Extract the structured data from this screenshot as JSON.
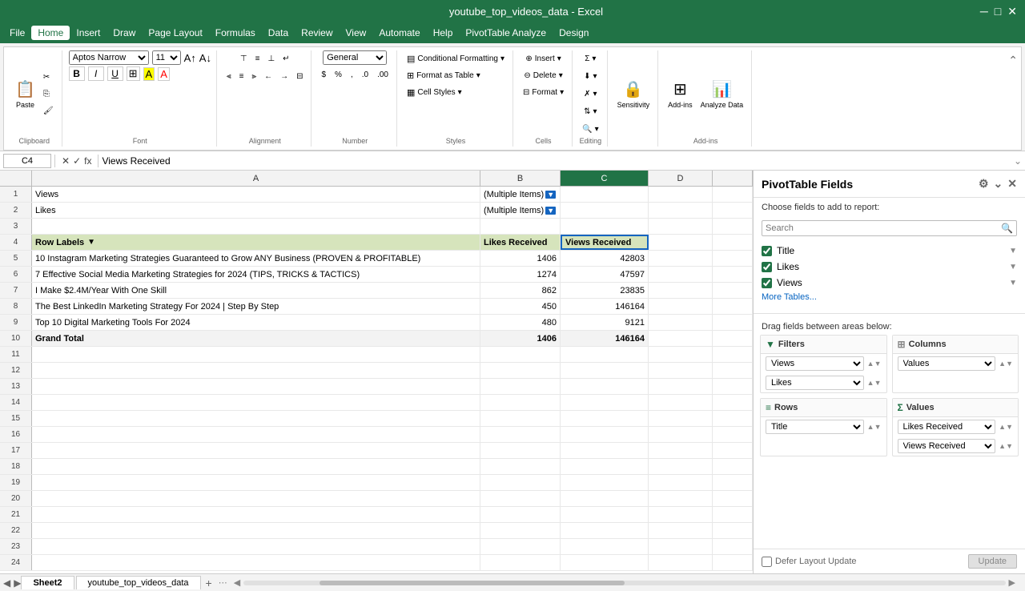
{
  "titleBar": {
    "title": "youtube_top_videos_data - Excel"
  },
  "menuBar": {
    "items": [
      "File",
      "Home",
      "Insert",
      "Draw",
      "Page Layout",
      "Formulas",
      "Data",
      "Review",
      "View",
      "Automate",
      "Help",
      "PivotTable Analyze",
      "Design"
    ]
  },
  "ribbon": {
    "groups": {
      "clipboard": {
        "label": "Clipboard",
        "paste": "Paste"
      },
      "font": {
        "label": "Font",
        "fontName": "Aptos Narrow",
        "fontSize": "11",
        "bold": "B",
        "italic": "I",
        "underline": "U"
      },
      "alignment": {
        "label": "Alignment"
      },
      "number": {
        "label": "Number",
        "format": "General"
      },
      "styles": {
        "label": "Styles",
        "conditionalFormatting": "Conditional Formatting",
        "formatAsTable": "Format as Table",
        "cellStyles": "Cell Styles"
      },
      "cells": {
        "label": "Cells",
        "insert": "Insert",
        "delete": "Delete",
        "format": "Format"
      },
      "editing": {
        "label": "Editing"
      },
      "sensitivity": {
        "label": "Sensitivity"
      },
      "addins": {
        "label": "Add-ins",
        "addins": "Add-ins",
        "analyzeData": "Analyze Data"
      }
    }
  },
  "formulaBar": {
    "cellRef": "C4",
    "formula": "Views Received"
  },
  "spreadsheet": {
    "columns": [
      "A",
      "B",
      "C",
      "D"
    ],
    "rows": [
      {
        "num": "1",
        "cells": [
          {
            "col": "A",
            "value": "Views",
            "type": "text"
          },
          {
            "col": "B",
            "value": "(Multiple Items)",
            "type": "text",
            "hasFilter": true
          },
          {
            "col": "C",
            "value": "",
            "type": "text"
          },
          {
            "col": "D",
            "value": "",
            "type": "text"
          }
        ]
      },
      {
        "num": "2",
        "cells": [
          {
            "col": "A",
            "value": "Likes",
            "type": "text"
          },
          {
            "col": "B",
            "value": "(Multiple Items)",
            "type": "text",
            "hasFilter": true
          },
          {
            "col": "C",
            "value": "",
            "type": "text"
          },
          {
            "col": "D",
            "value": "",
            "type": "text"
          }
        ]
      },
      {
        "num": "3",
        "cells": [
          {
            "col": "A",
            "value": "",
            "type": "text"
          },
          {
            "col": "B",
            "value": "",
            "type": "text"
          },
          {
            "col": "C",
            "value": "",
            "type": "text"
          },
          {
            "col": "D",
            "value": "",
            "type": "text"
          }
        ]
      },
      {
        "num": "4",
        "cells": [
          {
            "col": "A",
            "value": "Row Labels",
            "type": "header",
            "hasDropdown": true
          },
          {
            "col": "B",
            "value": "Likes Received",
            "type": "header"
          },
          {
            "col": "C",
            "value": "Views Received",
            "type": "header",
            "selected": true
          },
          {
            "col": "D",
            "value": "",
            "type": "text"
          }
        ]
      },
      {
        "num": "5",
        "cells": [
          {
            "col": "A",
            "value": "10 Instagram Marketing Strategies Guaranteed to Grow ANY Business (PROVEN & PROFITABLE)",
            "type": "text"
          },
          {
            "col": "B",
            "value": "1406",
            "type": "num"
          },
          {
            "col": "C",
            "value": "42803",
            "type": "num"
          },
          {
            "col": "D",
            "value": "",
            "type": "text"
          }
        ]
      },
      {
        "num": "6",
        "cells": [
          {
            "col": "A",
            "value": "7 Effective Social Media Marketing Strategies for 2024 (TIPS, TRICKS & TACTICS)",
            "type": "text"
          },
          {
            "col": "B",
            "value": "1274",
            "type": "num"
          },
          {
            "col": "C",
            "value": "47597",
            "type": "num"
          },
          {
            "col": "D",
            "value": "",
            "type": "text"
          }
        ]
      },
      {
        "num": "7",
        "cells": [
          {
            "col": "A",
            "value": "I Make $2.4M/Year With One Skill",
            "type": "text"
          },
          {
            "col": "B",
            "value": "862",
            "type": "num"
          },
          {
            "col": "C",
            "value": "23835",
            "type": "num"
          },
          {
            "col": "D",
            "value": "",
            "type": "text"
          }
        ]
      },
      {
        "num": "8",
        "cells": [
          {
            "col": "A",
            "value": "The Best LinkedIn Marketing Strategy For 2024 | Step By Step",
            "type": "text"
          },
          {
            "col": "B",
            "value": "450",
            "type": "num"
          },
          {
            "col": "C",
            "value": "146164",
            "type": "num"
          },
          {
            "col": "D",
            "value": "",
            "type": "text"
          }
        ]
      },
      {
        "num": "9",
        "cells": [
          {
            "col": "A",
            "value": "Top 10 Digital Marketing Tools For 2024",
            "type": "text"
          },
          {
            "col": "B",
            "value": "480",
            "type": "num"
          },
          {
            "col": "C",
            "value": "9121",
            "type": "num"
          },
          {
            "col": "D",
            "value": "",
            "type": "text"
          }
        ]
      },
      {
        "num": "10",
        "cells": [
          {
            "col": "A",
            "value": "Grand Total",
            "type": "total"
          },
          {
            "col": "B",
            "value": "1406",
            "type": "total-num"
          },
          {
            "col": "C",
            "value": "146164",
            "type": "total-num"
          },
          {
            "col": "D",
            "value": "",
            "type": "text"
          }
        ]
      },
      {
        "num": "11",
        "cells": [
          {
            "col": "A",
            "value": "",
            "type": "text"
          },
          {
            "col": "B",
            "value": "",
            "type": "text"
          },
          {
            "col": "C",
            "value": "",
            "type": "text"
          },
          {
            "col": "D",
            "value": "",
            "type": "text"
          }
        ]
      },
      {
        "num": "12",
        "cells": [
          {
            "col": "A",
            "value": "",
            "type": "text"
          },
          {
            "col": "B",
            "value": "",
            "type": "text"
          },
          {
            "col": "C",
            "value": "",
            "type": "text"
          },
          {
            "col": "D",
            "value": "",
            "type": "text"
          }
        ]
      },
      {
        "num": "13",
        "cells": [
          {
            "col": "A",
            "value": "",
            "type": "text"
          },
          {
            "col": "B",
            "value": "",
            "type": "text"
          },
          {
            "col": "C",
            "value": "",
            "type": "text"
          },
          {
            "col": "D",
            "value": "",
            "type": "text"
          }
        ]
      },
      {
        "num": "14",
        "cells": [
          {
            "col": "A",
            "value": "",
            "type": "text"
          },
          {
            "col": "B",
            "value": "",
            "type": "text"
          },
          {
            "col": "C",
            "value": "",
            "type": "text"
          },
          {
            "col": "D",
            "value": "",
            "type": "text"
          }
        ]
      },
      {
        "num": "15",
        "cells": [
          {
            "col": "A",
            "value": "",
            "type": "text"
          },
          {
            "col": "B",
            "value": "",
            "type": "text"
          },
          {
            "col": "C",
            "value": "",
            "type": "text"
          },
          {
            "col": "D",
            "value": "",
            "type": "text"
          }
        ]
      },
      {
        "num": "16",
        "cells": [
          {
            "col": "A",
            "value": "",
            "type": "text"
          },
          {
            "col": "B",
            "value": "",
            "type": "text"
          },
          {
            "col": "C",
            "value": "",
            "type": "text"
          },
          {
            "col": "D",
            "value": "",
            "type": "text"
          }
        ]
      },
      {
        "num": "17",
        "cells": [
          {
            "col": "A",
            "value": "",
            "type": "text"
          },
          {
            "col": "B",
            "value": "",
            "type": "text"
          },
          {
            "col": "C",
            "value": "",
            "type": "text"
          },
          {
            "col": "D",
            "value": "",
            "type": "text"
          }
        ]
      },
      {
        "num": "18",
        "cells": [
          {
            "col": "A",
            "value": "",
            "type": "text"
          },
          {
            "col": "B",
            "value": "",
            "type": "text"
          },
          {
            "col": "C",
            "value": "",
            "type": "text"
          },
          {
            "col": "D",
            "value": "",
            "type": "text"
          }
        ]
      },
      {
        "num": "19",
        "cells": [
          {
            "col": "A",
            "value": "",
            "type": "text"
          },
          {
            "col": "B",
            "value": "",
            "type": "text"
          },
          {
            "col": "C",
            "value": "",
            "type": "text"
          },
          {
            "col": "D",
            "value": "",
            "type": "text"
          }
        ]
      },
      {
        "num": "20",
        "cells": [
          {
            "col": "A",
            "value": "",
            "type": "text"
          },
          {
            "col": "B",
            "value": "",
            "type": "text"
          },
          {
            "col": "C",
            "value": "",
            "type": "text"
          },
          {
            "col": "D",
            "value": "",
            "type": "text"
          }
        ]
      },
      {
        "num": "21",
        "cells": [
          {
            "col": "A",
            "value": "",
            "type": "text"
          },
          {
            "col": "B",
            "value": "",
            "type": "text"
          },
          {
            "col": "C",
            "value": "",
            "type": "text"
          },
          {
            "col": "D",
            "value": "",
            "type": "text"
          }
        ]
      },
      {
        "num": "22",
        "cells": [
          {
            "col": "A",
            "value": "",
            "type": "text"
          },
          {
            "col": "B",
            "value": "",
            "type": "text"
          },
          {
            "col": "C",
            "value": "",
            "type": "text"
          },
          {
            "col": "D",
            "value": "",
            "type": "text"
          }
        ]
      },
      {
        "num": "23",
        "cells": [
          {
            "col": "A",
            "value": "",
            "type": "text"
          },
          {
            "col": "B",
            "value": "",
            "type": "text"
          },
          {
            "col": "C",
            "value": "",
            "type": "text"
          },
          {
            "col": "D",
            "value": "",
            "type": "text"
          }
        ]
      },
      {
        "num": "24",
        "cells": [
          {
            "col": "A",
            "value": "",
            "type": "text"
          },
          {
            "col": "B",
            "value": "",
            "type": "text"
          },
          {
            "col": "C",
            "value": "",
            "type": "text"
          },
          {
            "col": "D",
            "value": "",
            "type": "text"
          }
        ]
      }
    ]
  },
  "pivotPanel": {
    "title": "PivotTable Fields",
    "subtitle": "Choose fields to add to report:",
    "searchPlaceholder": "Search",
    "fields": [
      {
        "name": "Title",
        "checked": true
      },
      {
        "name": "Likes",
        "checked": true
      },
      {
        "name": "Views",
        "checked": true
      }
    ],
    "moreTables": "More Tables...",
    "dragLabel": "Drag fields between areas below:",
    "areas": {
      "filters": {
        "label": "Filters",
        "items": [
          "Views",
          "Likes"
        ]
      },
      "columns": {
        "label": "Columns",
        "items": [
          "Values"
        ]
      },
      "rows": {
        "label": "Rows",
        "items": [
          "Title"
        ]
      },
      "values": {
        "label": "Values",
        "items": [
          "Likes Received",
          "Views Received"
        ]
      }
    },
    "deferLabel": "Defer Layout Update",
    "updateLabel": "Update"
  },
  "bottomBar": {
    "sheets": [
      "Sheet2",
      "youtube_top_videos_data"
    ],
    "activeSheet": "Sheet2"
  }
}
